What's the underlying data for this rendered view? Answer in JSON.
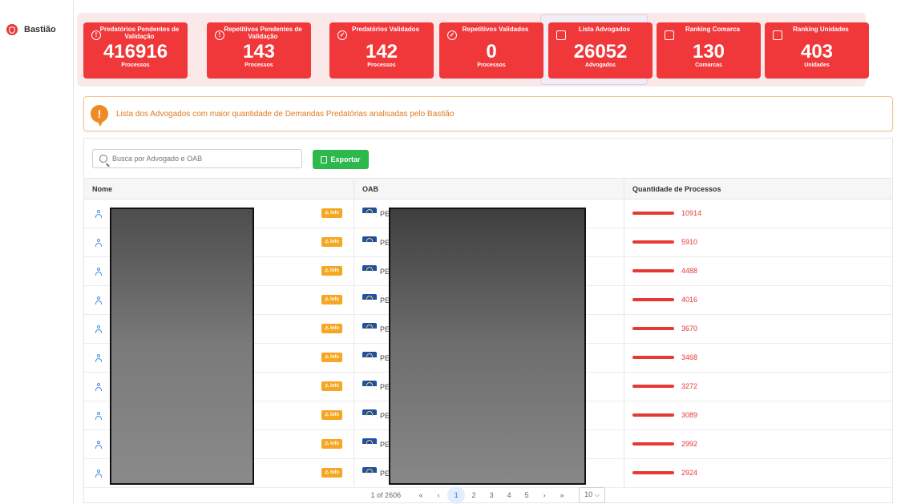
{
  "sidebar": {
    "brand_label": "Bastião"
  },
  "cards": [
    {
      "title": "Predatórios Pendentes de Validação",
      "value": "416916",
      "sub": "Processos",
      "icon": "alert-circle-icon"
    },
    {
      "title": "Repetitivos Pendentes de Validação",
      "value": "143",
      "sub": "Processos",
      "icon": "alert-circle-icon"
    },
    {
      "title": "Predatórios Validados",
      "value": "142",
      "sub": "Processos",
      "icon": "check-circle-icon"
    },
    {
      "title": "Repetitivos Validados",
      "value": "0",
      "sub": "Processos",
      "icon": "check-circle-icon"
    },
    {
      "title": "Lista Advogados",
      "value": "26052",
      "sub": "Advogados",
      "icon": "bar-chart-icon"
    },
    {
      "title": "Ranking Comarca",
      "value": "130",
      "sub": "Comarcas",
      "icon": "bar-chart-icon"
    },
    {
      "title": "Ranking Unidades",
      "value": "403",
      "sub": "Unidades",
      "icon": "bar-chart-icon"
    }
  ],
  "notice": {
    "icon": "!",
    "text": "Lista dos Advogados com maior quantidade de Demandas Predatórias analisadas pelo Bastião"
  },
  "search": {
    "placeholder": "Busca por Advogado e OAB"
  },
  "export": {
    "label": "Exportar"
  },
  "table": {
    "headers": [
      "Nome",
      "OAB",
      "Quantidade de Processos"
    ],
    "info_label": "⚠ Info",
    "oab_prefix": "PE",
    "rows": [
      {
        "qty": "10914"
      },
      {
        "qty": "5910"
      },
      {
        "qty": "4488"
      },
      {
        "qty": "4016"
      },
      {
        "qty": "3670"
      },
      {
        "qty": "3468"
      },
      {
        "qty": "3272"
      },
      {
        "qty": "3089"
      },
      {
        "qty": "2992"
      },
      {
        "qty": "2924"
      }
    ]
  },
  "pagination": {
    "summary": "1 of 2606",
    "first": "«",
    "prev": "‹",
    "pages": [
      "1",
      "2",
      "3",
      "4",
      "5"
    ],
    "next": "›",
    "last": "»",
    "page_size": "10 ⌵"
  },
  "colors": {
    "card_red": "#f0373a",
    "accent_green": "#2db84d",
    "notice_orange": "#f08a24"
  }
}
